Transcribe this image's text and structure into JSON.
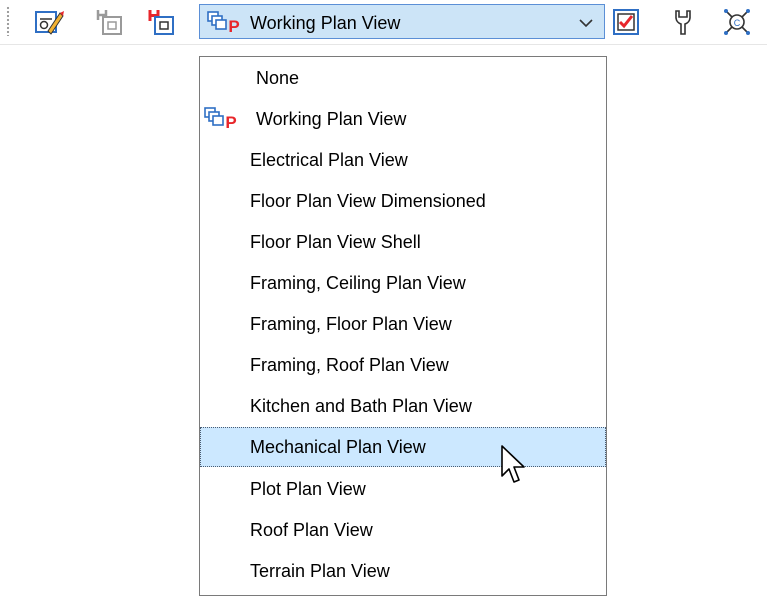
{
  "toolbar": {
    "icons": [
      "edit-plan-view-icon",
      "plan-view-icon",
      "plan-view-red-icon",
      "checklist-icon",
      "wrench-icon",
      "network-icon"
    ]
  },
  "view_selector": {
    "selected_label": "Working Plan View",
    "icon": "plan-view-p-icon"
  },
  "dropdown": {
    "items": [
      "None",
      "Working Plan View",
      "Electrical Plan View",
      "Floor Plan View Dimensioned",
      "Floor Plan View Shell",
      "Framing, Ceiling Plan View",
      "Framing, Floor Plan View",
      "Framing, Roof Plan View",
      "Kitchen and Bath Plan View",
      "Mechanical Plan View",
      "Plot Plan View",
      "Roof Plan View",
      "Terrain Plan View"
    ],
    "highlighted_index": 9
  },
  "colors": {
    "combo_bg": "#cce4f7",
    "highlight_bg": "#cce8ff",
    "accent_red": "#e8262b",
    "accent_blue": "#2f6fc4"
  }
}
